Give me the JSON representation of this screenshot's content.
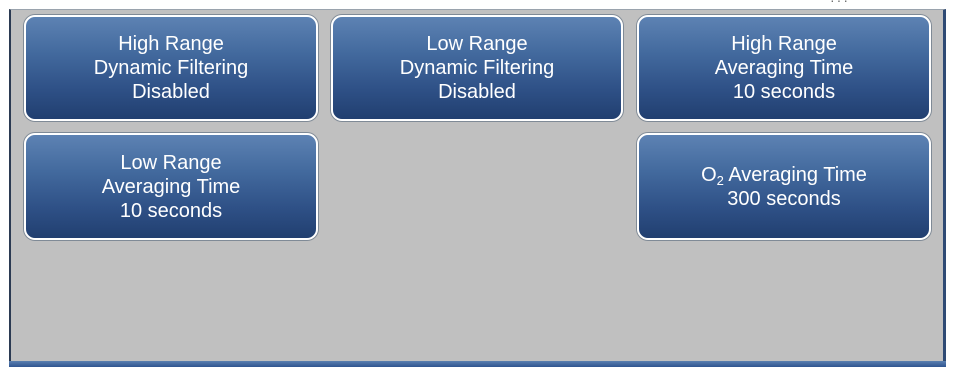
{
  "header": {
    "clipped_text": "···"
  },
  "buttons": [
    {
      "line1": "High Range",
      "line2": "Dynamic Filtering",
      "line3": "Disabled"
    },
    {
      "line1": "Low Range",
      "line2": "Dynamic Filtering",
      "line3": "Disabled"
    },
    {
      "line1": "High Range",
      "line2": "Averaging Time",
      "line3": "10 seconds"
    },
    {
      "line1": "Low Range",
      "line2": "Averaging Time",
      "line3": "10 seconds"
    },
    {
      "o2_prefix": "O",
      "o2_subscript": "2",
      "o2_suffix": " Averaging Time",
      "line2": "300 seconds"
    }
  ],
  "colors": {
    "button_top": "#5d82b3",
    "button_bottom": "#213f70",
    "panel_background": "#c0c0c0",
    "button_text": "#ffffff"
  }
}
